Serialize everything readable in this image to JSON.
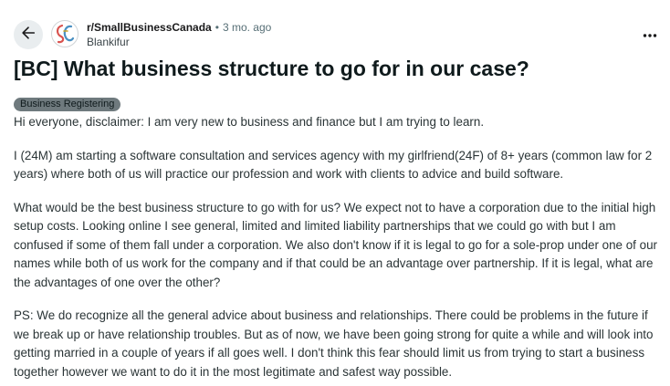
{
  "post": {
    "subreddit": "r/SmallBusinessCanada",
    "separator": "•",
    "time_ago": "3 mo. ago",
    "author": "Blankifur",
    "title": "[BC] What business structure to go for in our case?",
    "flair": "Business Registering",
    "paragraphs": [
      "Hi everyone, disclaimer: I am very new to business and finance but I am trying to learn.",
      "I (24M) am starting a software consultation and services agency with my girlfriend(24F) of 8+ years (common law for 2 years) where both of us will practice our profession and work with clients to advice and build software.",
      "What would be the best business structure to go with for us? We expect not to have a corporation due to the initial high setup costs. Looking online I see general, limited and limited liability partnerships that we could go with but I am confused if some of them fall under a corporation. We also don't know if it is legal to go for a sole-prop under one of our names while both of us work for the company and if that could be an advantage over partnership. If it is legal, what are the advantages of one over the other?",
      "PS: We do recognize all the general advice about business and relationships. There could be problems in the future if we break up or have relationship troubles. But as of now, we have been going strong for quite a while and will look into getting married in a couple of years if all goes well. I don't think this fear should limit us from trying to start a business together however we want to do it in the most legitimate and safest way possible."
    ]
  },
  "icons": {
    "back": "arrow-left-icon",
    "avatar": "subreddit-avatar",
    "more": "ellipsis-icon"
  },
  "colors": {
    "back_button_bg": "#e9edef",
    "flair_bg": "#6f7a7e",
    "meta_text": "#576f76",
    "body_text": "#2a3436"
  }
}
